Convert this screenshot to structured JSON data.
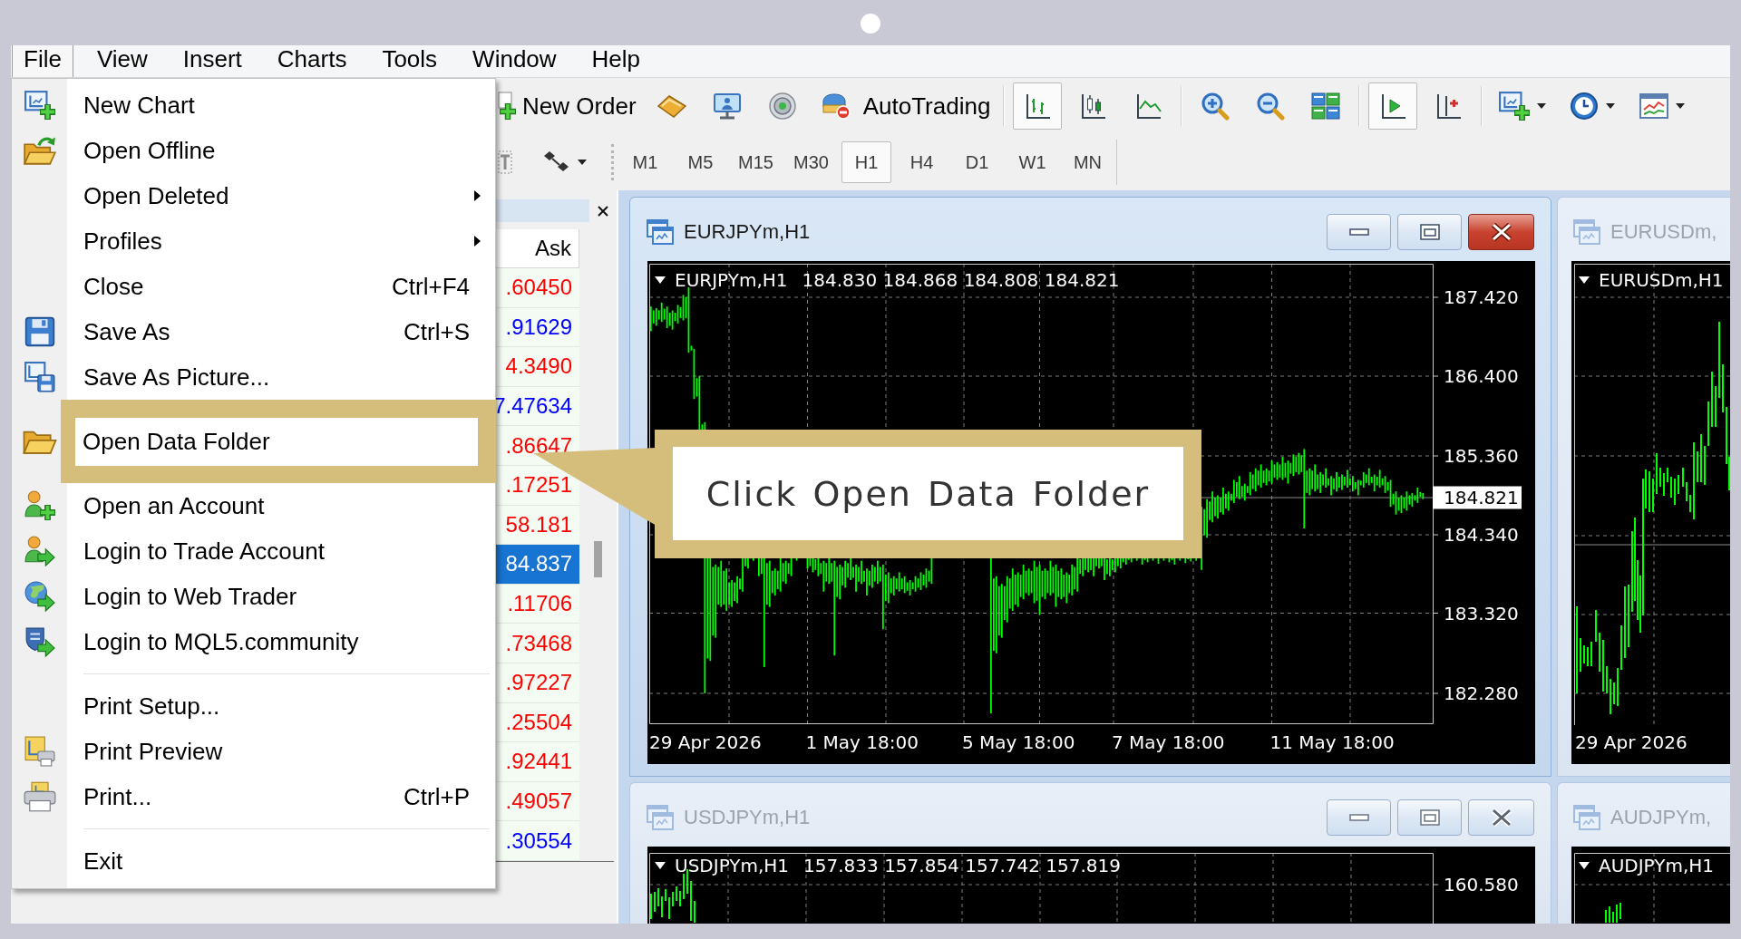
{
  "menu_bar": [
    {
      "label": "File",
      "selected": true
    },
    {
      "label": "View",
      "selected": false
    },
    {
      "label": "Insert",
      "selected": false
    },
    {
      "label": "Charts",
      "selected": false
    },
    {
      "label": "Tools",
      "selected": false
    },
    {
      "label": "Window",
      "selected": false
    },
    {
      "label": "Help",
      "selected": false
    }
  ],
  "file_menu": {
    "groups": [
      {
        "items": [
          {
            "label": "New Chart",
            "submenu": false,
            "highlighted": false
          },
          {
            "label": "Open Offline",
            "submenu": false,
            "highlighted": false
          },
          {
            "label": "Open Deleted",
            "submenu": true,
            "highlighted": false
          },
          {
            "label": "Profiles",
            "submenu": true,
            "highlighted": false
          },
          {
            "label": "Close",
            "shortcut": "Ctrl+F4",
            "submenu": false,
            "highlighted": false
          },
          {
            "label": "Save As",
            "shortcut": "Ctrl+S",
            "submenu": false,
            "highlighted": false
          },
          {
            "label": "Save As Picture...",
            "submenu": false,
            "highlighted": false
          }
        ]
      },
      {
        "items": [
          {
            "label": "Open Data Folder",
            "submenu": false,
            "highlighted": true
          }
        ]
      },
      {
        "items": [
          {
            "label": "Open an Account",
            "submenu": false,
            "highlighted": false
          },
          {
            "label": "Login to Trade Account",
            "submenu": false,
            "highlighted": false
          },
          {
            "label": "Login to Web Trader",
            "submenu": false,
            "highlighted": false
          },
          {
            "label": "Login to MQL5.community",
            "submenu": false,
            "highlighted": false
          }
        ]
      },
      {
        "items": [
          {
            "label": "Print Setup...",
            "submenu": false,
            "highlighted": false
          },
          {
            "label": "Print Preview",
            "submenu": false,
            "highlighted": false
          },
          {
            "label": "Print...",
            "shortcut": "Ctrl+P",
            "submenu": false,
            "highlighted": false
          }
        ]
      },
      {
        "items": [
          {
            "label": "Exit",
            "submenu": false,
            "highlighted": false
          }
        ]
      }
    ]
  },
  "toolbar": {
    "new_order": "New Order",
    "auto_trading": "AutoTrading",
    "chart_types": [
      {
        "selected": true
      },
      {
        "selected": false
      },
      {
        "selected": false
      }
    ],
    "auto_scroll": {
      "on": true
    },
    "chart_shift": {
      "on": false
    },
    "timeframes": [
      {
        "label": "M1",
        "selected": false
      },
      {
        "label": "M5",
        "selected": false
      },
      {
        "label": "M15",
        "selected": false
      },
      {
        "label": "M30",
        "selected": false
      },
      {
        "label": "H1",
        "selected": true
      },
      {
        "label": "H4",
        "selected": false
      },
      {
        "label": "D1",
        "selected": false
      },
      {
        "label": "W1",
        "selected": false
      },
      {
        "label": "MN",
        "selected": false
      }
    ]
  },
  "market_watch": {
    "column": "Ask",
    "rows": [
      {
        "ask": ".60450",
        "color": "#ff0000",
        "selected": false
      },
      {
        "ask": ".91629",
        "color": "#0000ff",
        "selected": false
      },
      {
        "ask": "4.3490",
        "color": "#ff0000",
        "selected": false
      },
      {
        "ask": "7.47634",
        "color": "#0000ff",
        "selected": false
      },
      {
        "ask": ".86647",
        "color": "#ff0000",
        "selected": false
      },
      {
        "ask": ".17251",
        "color": "#ff0000",
        "selected": false
      },
      {
        "ask": "58.181",
        "color": "#ff0000",
        "selected": false
      },
      {
        "ask": "84.837",
        "selected": true
      },
      {
        "ask": ".11706",
        "color": "#ff0000",
        "selected": false
      },
      {
        "ask": ".73468",
        "color": "#ff0000",
        "selected": false
      },
      {
        "ask": ".97227",
        "color": "#ff0000",
        "selected": false
      },
      {
        "ask": ".25504",
        "color": "#ff0000",
        "selected": false
      },
      {
        "ask": ".92441",
        "color": "#ff0000",
        "selected": false
      },
      {
        "ask": ".49057",
        "color": "#ff0000",
        "selected": false
      },
      {
        "ask": ".30554",
        "color": "#0000ff",
        "selected": false
      }
    ]
  },
  "charts": [
    {
      "title": "EURJPYm,H1",
      "active": true,
      "symbol": "EURJPYm,H1",
      "ohlc": "184.830 184.868 184.808 184.821",
      "y_labels": [
        "187.420",
        "186.400",
        "185.360",
        "184.340",
        "183.320",
        "182.280"
      ],
      "x_labels": [
        "29 Apr 2026",
        "1 May 18:00",
        "5 May 18:00",
        "7 May 18:00",
        "11 May 18:00"
      ],
      "price_label": "184.821"
    },
    {
      "title": "EURUSDm,",
      "active": false,
      "symbol": "EURUSDm,H1",
      "x_labels": [
        "29 Apr 2026"
      ]
    },
    {
      "title": "USDJPYm,H1",
      "active": false,
      "symbol": "USDJPYm,H1",
      "ohlc": "157.833 157.854 157.742 157.819",
      "y_labels": [
        "160.580"
      ]
    },
    {
      "title": "AUDJPYm,",
      "active": false,
      "symbol": "AUDJPYm,H1"
    }
  ],
  "callout": {
    "text": "Click Open Data Folder"
  }
}
